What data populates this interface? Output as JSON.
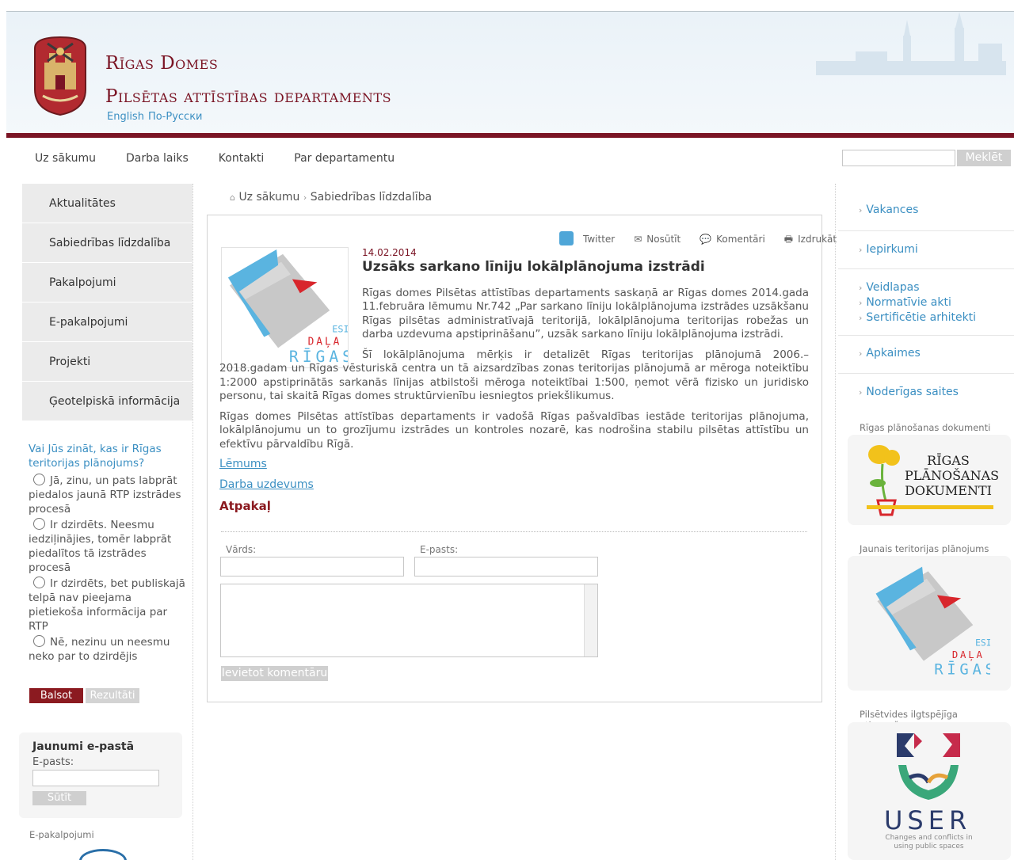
{
  "header": {
    "org": "Rīgas Domes",
    "dept": "Pilsētas attīstības departaments",
    "langs": [
      "English",
      "По-Русски"
    ]
  },
  "topnav": [
    "Uz sākumu",
    "Darba laiks",
    "Kontakti",
    "Par departamentu"
  ],
  "search": {
    "button": "Meklēt",
    "placeholder": ""
  },
  "leftnav": [
    "Aktualitātes",
    "Sabiedrības līdzdalība",
    "Pakalpojumi",
    "E-pakalpojumi",
    "Projekti",
    "Ģeotelpiskā informācija"
  ],
  "poll": {
    "question": "Vai Jūs zināt, kas ir Rīgas teritorijas plānojums?",
    "options": [
      "Jā, zinu, un pats labprāt piedalos jaunā RTP izstrādes procesā",
      "Ir dzirdēts. Neesmu iedziļinājies, tomēr labprāt piedalītos tā izstrādes procesā",
      "Ir dzirdēts, bet publiskajā telpā nav pieejama pietiekoša informācija par RTP",
      "Nē, nezinu un neesmu neko par to dzirdējis"
    ],
    "vote": "Balsot",
    "results": "Rezultāti"
  },
  "newsletter": {
    "title": "Jaunumi e-pastā",
    "label": "E-pasts:",
    "button": "Sūtīt"
  },
  "eservices_label": "E-pakalpojumi",
  "breadcrumb": {
    "home": "Uz sākumu",
    "current": "Sabiedrības līdzdalība",
    "sep": "›"
  },
  "tools": [
    "Twitter",
    "Nosūtīt",
    "Komentāri",
    "Izdrukāt"
  ],
  "article": {
    "date": "14.02.2014",
    "title": "Uzsāks sarkano līniju lokālplānojuma izstrādi",
    "p1": "Rīgas domes Pilsētas attīstības departaments saskaņā ar Rīgas domes 2014.gada 11.februāra lēmumu Nr.742 „Par sarkano līniju lokālplānojuma izstrādes uzsākšanu Rīgas pilsētas administratīvajā teritorijā, lokālplānojuma teritorijas robežas un darba uzdevuma apstiprināšanu”, uzsāk sarkano līniju lokālplānojuma izstrādi.",
    "p2": "Šī lokālplānojuma mērķis ir detalizēt Rīgas teritorijas plānojumā 2006.–2018.gadam un Rīgas vēsturiskā centra un tā aizsardzības zonas teritorijas plānojumā ar mēroga noteiktību 1:2000 apstiprinātās sarkanās līnijas atbilstoši mēroga noteiktībai 1:500, ņemot vērā fizisko un juridisko personu, tai skaitā Rīgas domes struktūrvienību iesniegtos priekšlikumus.",
    "p3": "Rīgas domes Pilsētas attīstības departaments ir vadošā Rīgas pašvaldības iestāde teritorijas plānojuma, lokālplānojumu un to grozījumu izstrādes un kontroles nozarē, kas nodrošina stabilu pilsētas attīstību un efektīvu pārvaldību Rīgā.",
    "link1": "Lēmums",
    "link2": "Darba uzdevums",
    "back": "Atpakaļ",
    "thumb_text": {
      "esi": "ESI",
      "dala": "DAĻA",
      "rigas": "RĪGAS"
    }
  },
  "comment": {
    "name_label": "Vārds:",
    "email_label": "E-pasts:",
    "submit": "Ievietot komentāru"
  },
  "right": {
    "links": [
      [
        "Vakances"
      ],
      [
        "Iepirkumi"
      ],
      [
        "Veidlapas",
        "Normatīvie akti",
        "Sertificētie arhitekti"
      ],
      [
        "Apkaimes"
      ],
      [
        "Noderīgas saites"
      ]
    ],
    "plan_docs_label": "Rīgas plānošanas dokumenti",
    "plan_docs_logo": "RĪGAS PLĀNOŠANAS DOKUMENTI",
    "new_plan_label": "Jaunais teritorijas plānojums",
    "renewal_label": "Pilsētvides ilgtspējīga atjaunošana",
    "user_logo": "USER",
    "user_sub": "Changes and conflicts in using public spaces"
  },
  "colors": {
    "accent": "#7a1424",
    "link": "#3b8fc2"
  }
}
